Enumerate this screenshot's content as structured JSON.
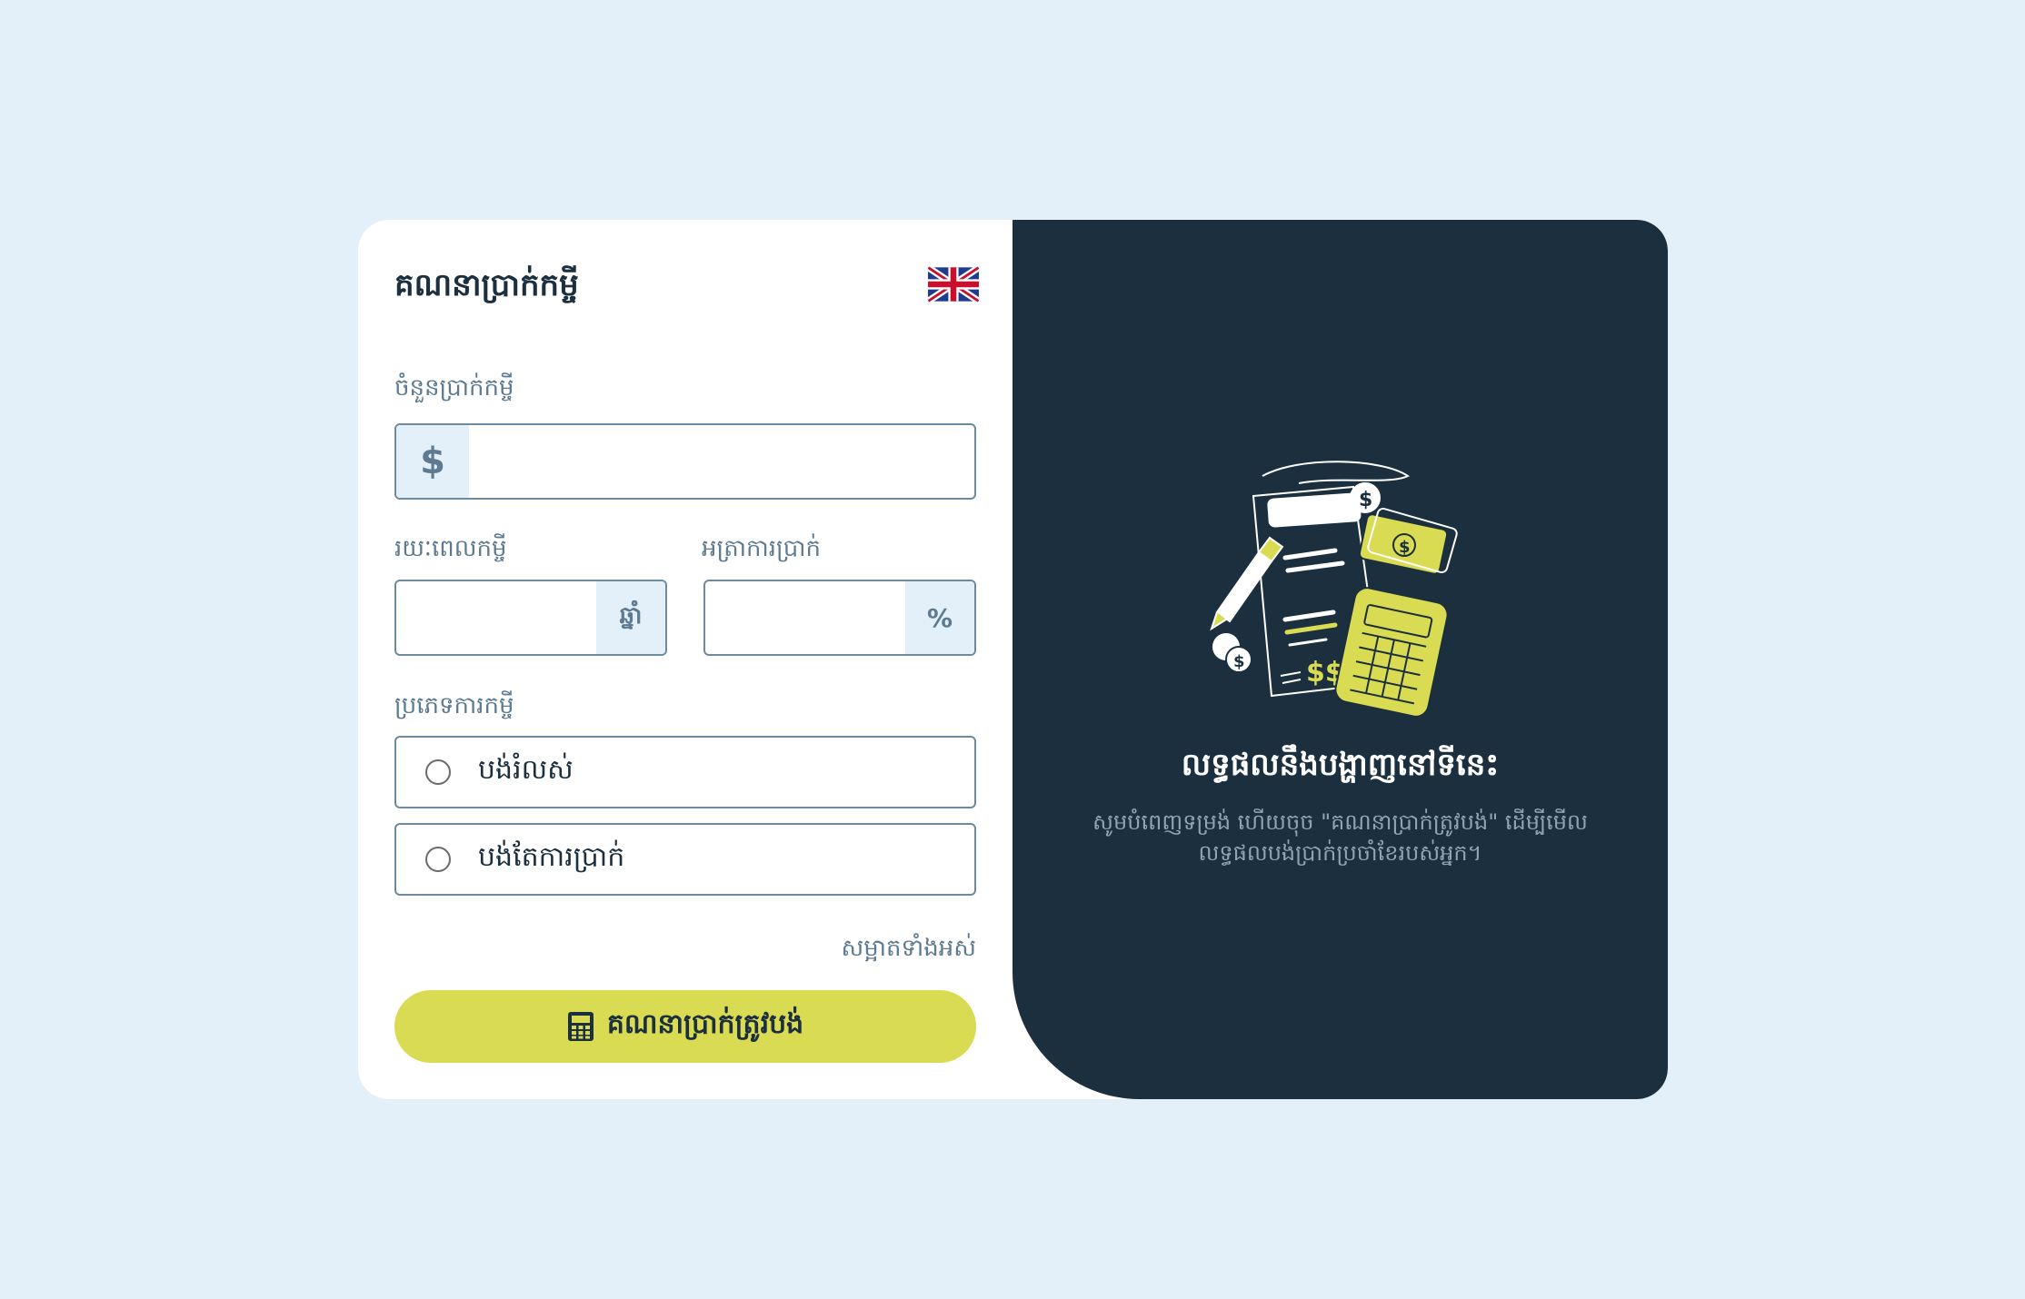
{
  "form": {
    "title": "គណនាប្រាក់កម្ចី",
    "language_flag": "uk-flag-icon",
    "loan_amount": {
      "label": "ចំនួនប្រាក់កម្ចី",
      "prefix": "$",
      "value": "",
      "placeholder": ""
    },
    "loan_term": {
      "label": "រយៈពេលកម្ចី",
      "suffix": "ឆ្នាំ",
      "value": "",
      "placeholder": ""
    },
    "interest_rate": {
      "label": "អត្រាការប្រាក់",
      "suffix": "%",
      "value": "",
      "placeholder": ""
    },
    "loan_type": {
      "label": "ប្រភេទការកម្ចី",
      "options": [
        {
          "label": "បង់រំលស់",
          "selected": false
        },
        {
          "label": "បង់តែការប្រាក់",
          "selected": false
        }
      ]
    },
    "clear_label": "សម្អាតទាំងអស់",
    "calculate_label": "គណនាប្រាក់ត្រូវបង់"
  },
  "result": {
    "title": "លទ្ធផលនឹងបង្ហាញនៅទីនេះ",
    "description": "សូមបំពេញទម្រង់ ហើយចុច \"គណនាប្រាក់ត្រូវបង់\" ដើម្បីមើលលទ្ធផលបង់ប្រាក់ប្រចាំខែរបស់អ្នក។",
    "illustration": "finance-calculator-illustration"
  },
  "colors": {
    "background": "#e3f0f9",
    "panel_dark": "#1b2f3e",
    "accent": "#d9dc52",
    "muted": "#5d7a90"
  }
}
